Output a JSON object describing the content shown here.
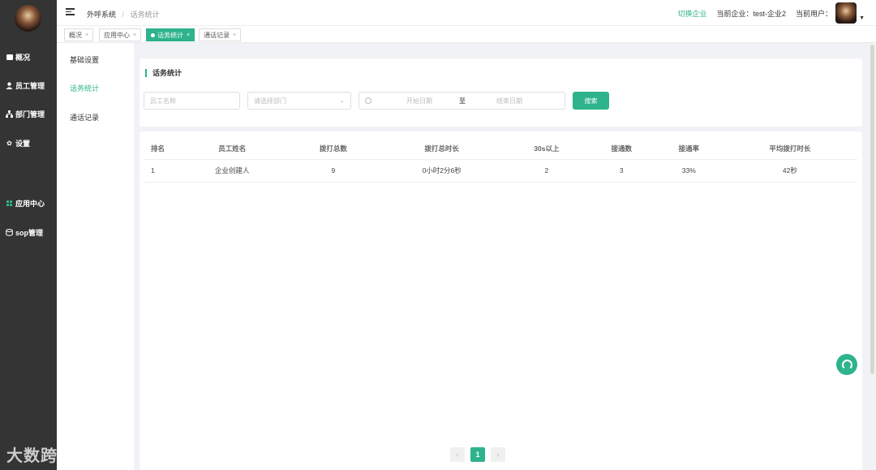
{
  "sidebar": {
    "items": [
      {
        "label": "概况",
        "icon": "monitor-icon"
      },
      {
        "label": "员工管理",
        "icon": "user-icon"
      },
      {
        "label": "部门管理",
        "icon": "org-chart-icon"
      },
      {
        "label": "设置",
        "icon": "gear-icon"
      },
      {
        "label": "应用中心",
        "icon": "grid-icon"
      },
      {
        "label": "sop管理",
        "icon": "database-icon"
      }
    ]
  },
  "header": {
    "breadcrumb": [
      "外呼系统",
      "话务统计"
    ],
    "separator": "/",
    "switch_label": "切换企业",
    "company_label": "当前企业：test-企业2",
    "user_label": "当前用户："
  },
  "tabs": [
    {
      "label": "概况",
      "active": false
    },
    {
      "label": "应用中心",
      "active": false
    },
    {
      "label": "话务统计",
      "active": true
    },
    {
      "label": "通话记录",
      "active": false
    }
  ],
  "close_mark": "×",
  "subnav": {
    "items": [
      "基础设置",
      "话务统计",
      "通话记录"
    ],
    "active_index": 1
  },
  "filter": {
    "title": "话务统计",
    "employee_placeholder": "员工名称",
    "department_placeholder": "请选择部门",
    "start_date": "开始日期",
    "to": "至",
    "end_date": "结束日期",
    "search_label": "搜索"
  },
  "table": {
    "columns": [
      "排名",
      "员工姓名",
      "拨打总数",
      "拨打总时长",
      "30s以上",
      "接通数",
      "接通率",
      "平均拨打时长"
    ],
    "rows": [
      [
        "1",
        "企业创建人",
        "9",
        "0小时2分6秒",
        "2",
        "3",
        "33%",
        "42秒"
      ]
    ]
  },
  "pagination": {
    "prev": "‹",
    "current": "1",
    "next": "›"
  },
  "watermark": "大数跨境",
  "colors": {
    "accent": "#2eb38c",
    "sidebar": "#343434"
  }
}
